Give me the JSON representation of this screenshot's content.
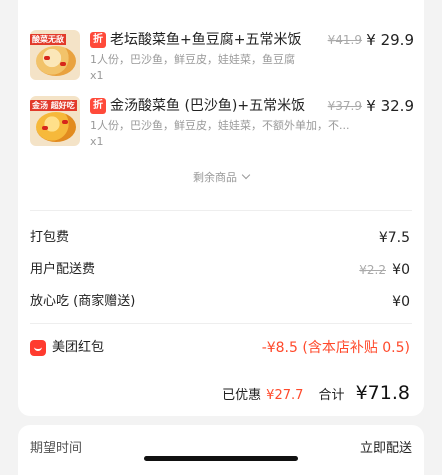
{
  "items": [
    {
      "thumb_banner": "酸菜无敌",
      "discount_tag": "折",
      "title": "老坛酸菜鱼+鱼豆腐+五常米饭",
      "original_price": "¥41.9",
      "price": "¥ 29.9",
      "desc": "1人份，巴沙鱼，鲜豆皮，娃娃菜，鱼豆腐",
      "qty": "x1"
    },
    {
      "thumb_banner": "金汤 超好吃",
      "discount_tag": "折",
      "title": "金汤酸菜鱼 (巴沙鱼)+五常米饭",
      "original_price": "¥37.9",
      "price": "¥ 32.9",
      "desc": "1人份，巴沙鱼，鲜豆皮，娃娃菜，不额外单加，不...",
      "qty": "x1"
    }
  ],
  "more": {
    "label": "剩余商品"
  },
  "fees": {
    "packing": {
      "label": "打包费",
      "value": "¥7.5"
    },
    "delivery": {
      "label": "用户配送费",
      "original": "¥2.2",
      "value": "¥0"
    },
    "assurance": {
      "label": "放心吃 (商家赠送)",
      "value": "¥0"
    }
  },
  "red_packet": {
    "label": "美团红包",
    "value": "-¥8.5 (含本店补贴 0.5)"
  },
  "summary": {
    "saved_label": "已优惠",
    "saved_value": "¥27.7",
    "total_label": "合计",
    "total_value": "¥71.8"
  },
  "delivery_time": {
    "label": "期望时间",
    "value": "立即配送"
  },
  "colors": {
    "accent": "#ff4a2c",
    "tag": "#ff4a3a",
    "background": "#f3f3f3"
  }
}
